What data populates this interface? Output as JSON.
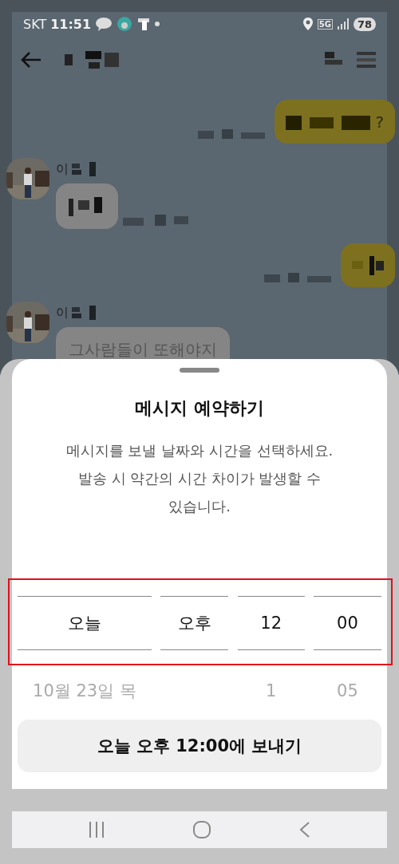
{
  "status_bar": {
    "carrier": "SKT",
    "time": "11:51",
    "network": "5G",
    "battery": "78"
  },
  "chat": {
    "messages": [
      {
        "kind": "sent",
        "text": "?"
      },
      {
        "kind": "received",
        "sender": "이"
      },
      {
        "kind": "sent"
      },
      {
        "kind": "received",
        "sender": "이",
        "text": "그사람들이 또해야지"
      }
    ]
  },
  "sheet": {
    "title": "메시지 예약하기",
    "description": "메시지를 보낼 날짜와 시간을 선택하세요.\n발송 시 약간의 시간 차이가 발생할 수\n있습니다.",
    "picker": {
      "columns": [
        {
          "items": [
            {
              "label": "오늘",
              "selected": true
            },
            {
              "label": "10월 23일 목",
              "selected": false
            }
          ]
        },
        {
          "items": [
            {
              "label": "오후",
              "selected": true
            }
          ]
        },
        {
          "items": [
            {
              "label": "12",
              "selected": true
            },
            {
              "label": "1",
              "selected": false
            }
          ]
        },
        {
          "items": [
            {
              "label": "00",
              "selected": true
            },
            {
              "label": "05",
              "selected": false
            }
          ]
        }
      ]
    },
    "send_button": "오늘 오후 12:00에 보내기"
  }
}
